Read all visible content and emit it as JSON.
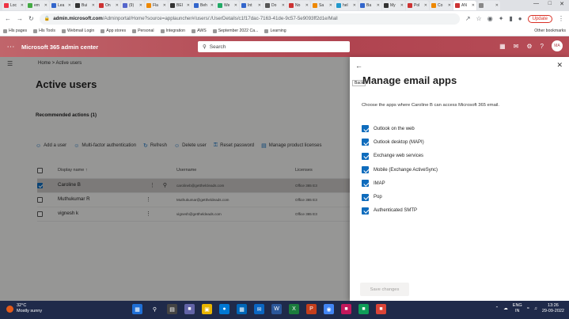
{
  "browser": {
    "tabs": [
      "Loc",
      "em",
      "Lea",
      "Bui",
      "On",
      "(9)",
      "Fla",
      "BEI",
      "Beh",
      "We",
      "Int",
      "Do",
      "No",
      "Sa",
      "hel",
      "Ba",
      "My",
      "Pol",
      "Co",
      "AN",
      ""
    ],
    "url_host": "admin.microsoft.com",
    "url_path": "/Adminportal/Home?source=applauncher#/users/:/UserDetails/c1f17dac-7163-41de-9c57-5e9093ff2d1e/Mail",
    "update_label": "Update",
    "bookmarks": [
      "Hls pages",
      "Hls Tools",
      "Webmail Login",
      "App stores",
      "Personal",
      "Integration",
      "AWS",
      "September 2022 Ca...",
      "Learning"
    ],
    "other_bookmarks": "Other bookmarks"
  },
  "header": {
    "title": "Microsoft 365 admin center",
    "search_placeholder": "Search",
    "avatar": "MA"
  },
  "page": {
    "breadcrumb": "Home  >  Active users",
    "title": "Active users",
    "recommended": "Recommended actions (1)",
    "commands": [
      "Add a user",
      "Multi-factor authentication",
      "Refresh",
      "Delete user",
      "Reset password",
      "Manage product licenses"
    ],
    "columns": [
      "Display name ↑",
      "Username",
      "Licenses"
    ],
    "rows": [
      {
        "name": "Caroline B",
        "username": "carolineb@getthelcleads.com",
        "license": "Office 365 E3",
        "selected": true
      },
      {
        "name": "Muthukumar R",
        "username": "Muthukumar@gettheldeads.com",
        "license": "Office 365 E3",
        "selected": false
      },
      {
        "name": "vignesh k",
        "username": "vignesh@gettheldeads.com",
        "license": "Office 365 E3",
        "selected": false
      }
    ]
  },
  "panel": {
    "back_tooltip": "Back",
    "title": "Manage email apps",
    "description": "Choose the apps where Caroline B can access Microsoft 365 email.",
    "apps": [
      "Outlook on the web",
      "Outlook desktop (MAPI)",
      "Exchange web services",
      "Mobile (Exchange ActiveSync)",
      "IMAP",
      "Pop",
      "Authenticated SMTP"
    ],
    "save_label": "Save changes"
  },
  "taskbar": {
    "temp": "32°C",
    "weather": "Mostly sunny",
    "lang": "ENG",
    "region": "IN",
    "time": "13:26",
    "date": "29-09-2022"
  },
  "colors": {
    "brand": "#b04450",
    "accent": "#0f6cbd",
    "taskbar": "#1f2a4a"
  }
}
